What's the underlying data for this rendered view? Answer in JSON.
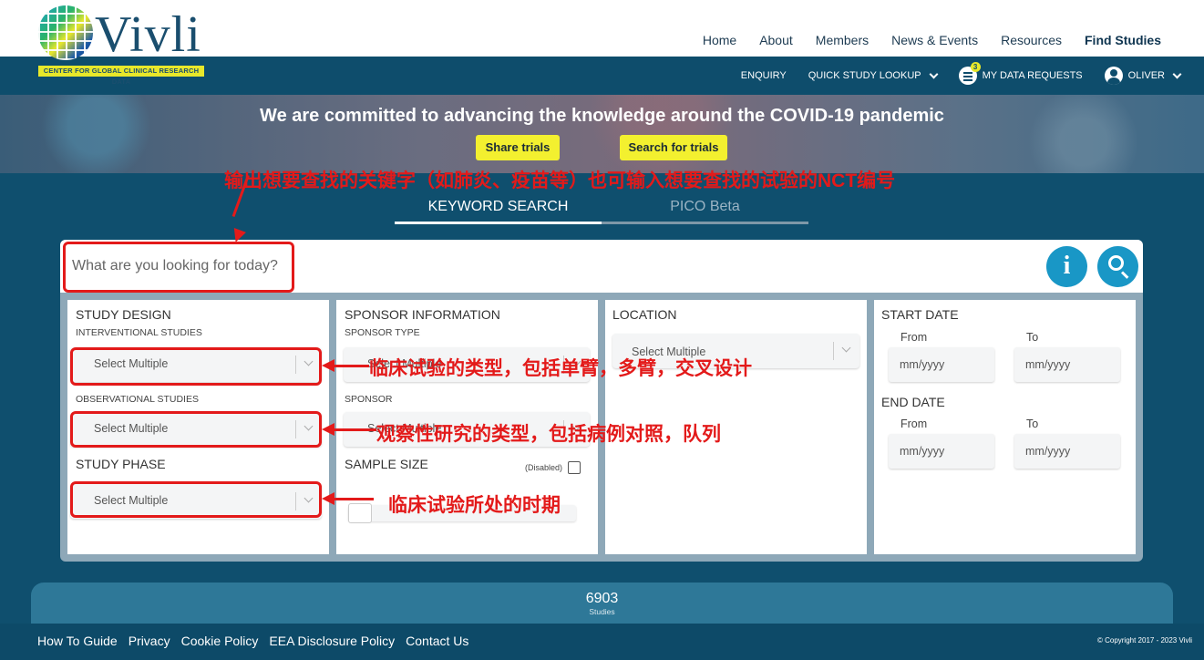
{
  "logo": {
    "word": "Vivli",
    "tagline": "CENTER FOR GLOBAL CLINICAL RESEARCH DATA"
  },
  "nav": {
    "items": [
      "Home",
      "About",
      "Members",
      "News & Events",
      "Resources",
      "Find Studies"
    ],
    "active": "Find Studies"
  },
  "subnav": {
    "enquiry": "ENQUIRY",
    "quick_lookup": "QUICK STUDY LOOKUP",
    "data_requests": "MY DATA REQUESTS",
    "requests_badge": "3",
    "user": "OLIVER"
  },
  "hero": {
    "title": "We are committed to advancing the knowledge around the COVID-19 pandemic",
    "share_button": "Share trials",
    "search_button": "Search for trials"
  },
  "tabs": {
    "keyword": "KEYWORD SEARCH",
    "pico": "PICO Beta"
  },
  "search": {
    "placeholder": "What are you looking for today?"
  },
  "filters": {
    "study_design": {
      "title": "STUDY DESIGN",
      "interventional_label": "INTERVENTIONAL STUDIES",
      "interventional_placeholder": "Select Multiple",
      "observational_label": "OBSERVATIONAL STUDIES",
      "observational_placeholder": "Select Multiple"
    },
    "study_phase": {
      "title": "STUDY PHASE",
      "placeholder": "Select Multiple"
    },
    "sponsor": {
      "title": "SPONSOR INFORMATION",
      "type_label": "SPONSOR TYPE",
      "type_placeholder": "Select Multiple",
      "sponsor_label": "SPONSOR",
      "sponsor_placeholder": "Select Multiple"
    },
    "sample_size": {
      "title": "SAMPLE SIZE",
      "disabled_label": "(Disabled)"
    },
    "location": {
      "title": "LOCATION",
      "placeholder": "Select Multiple"
    },
    "start_date": {
      "title": "START DATE",
      "from_label": "From",
      "to_label": "To",
      "from_placeholder": "mm/yyyy",
      "to_placeholder": "mm/yyyy"
    },
    "end_date": {
      "title": "END DATE",
      "from_label": "From",
      "to_label": "To",
      "from_placeholder": "mm/yyyy",
      "to_placeholder": "mm/yyyy"
    }
  },
  "annotations": {
    "keyword_hint": "输出想要查找的关键字（如肺炎、疫苗等）也可输入想要查找的试验的NCT编号",
    "interventional_hint": "临床试验的类型，包括单臂，多臂，交叉设计",
    "observational_hint": "观察性研究的类型，包括病例对照，队列",
    "phase_hint": "临床试验所处的时期",
    "color": "#e31a1a"
  },
  "stats": {
    "count": "6903",
    "label": "Studies"
  },
  "footer": {
    "links": [
      "How To Guide",
      "Privacy",
      "Cookie Policy",
      "EEA Disclosure Policy",
      "Contact Us"
    ],
    "copyright": "© Copyright 2017 - 2023 Vivli"
  }
}
